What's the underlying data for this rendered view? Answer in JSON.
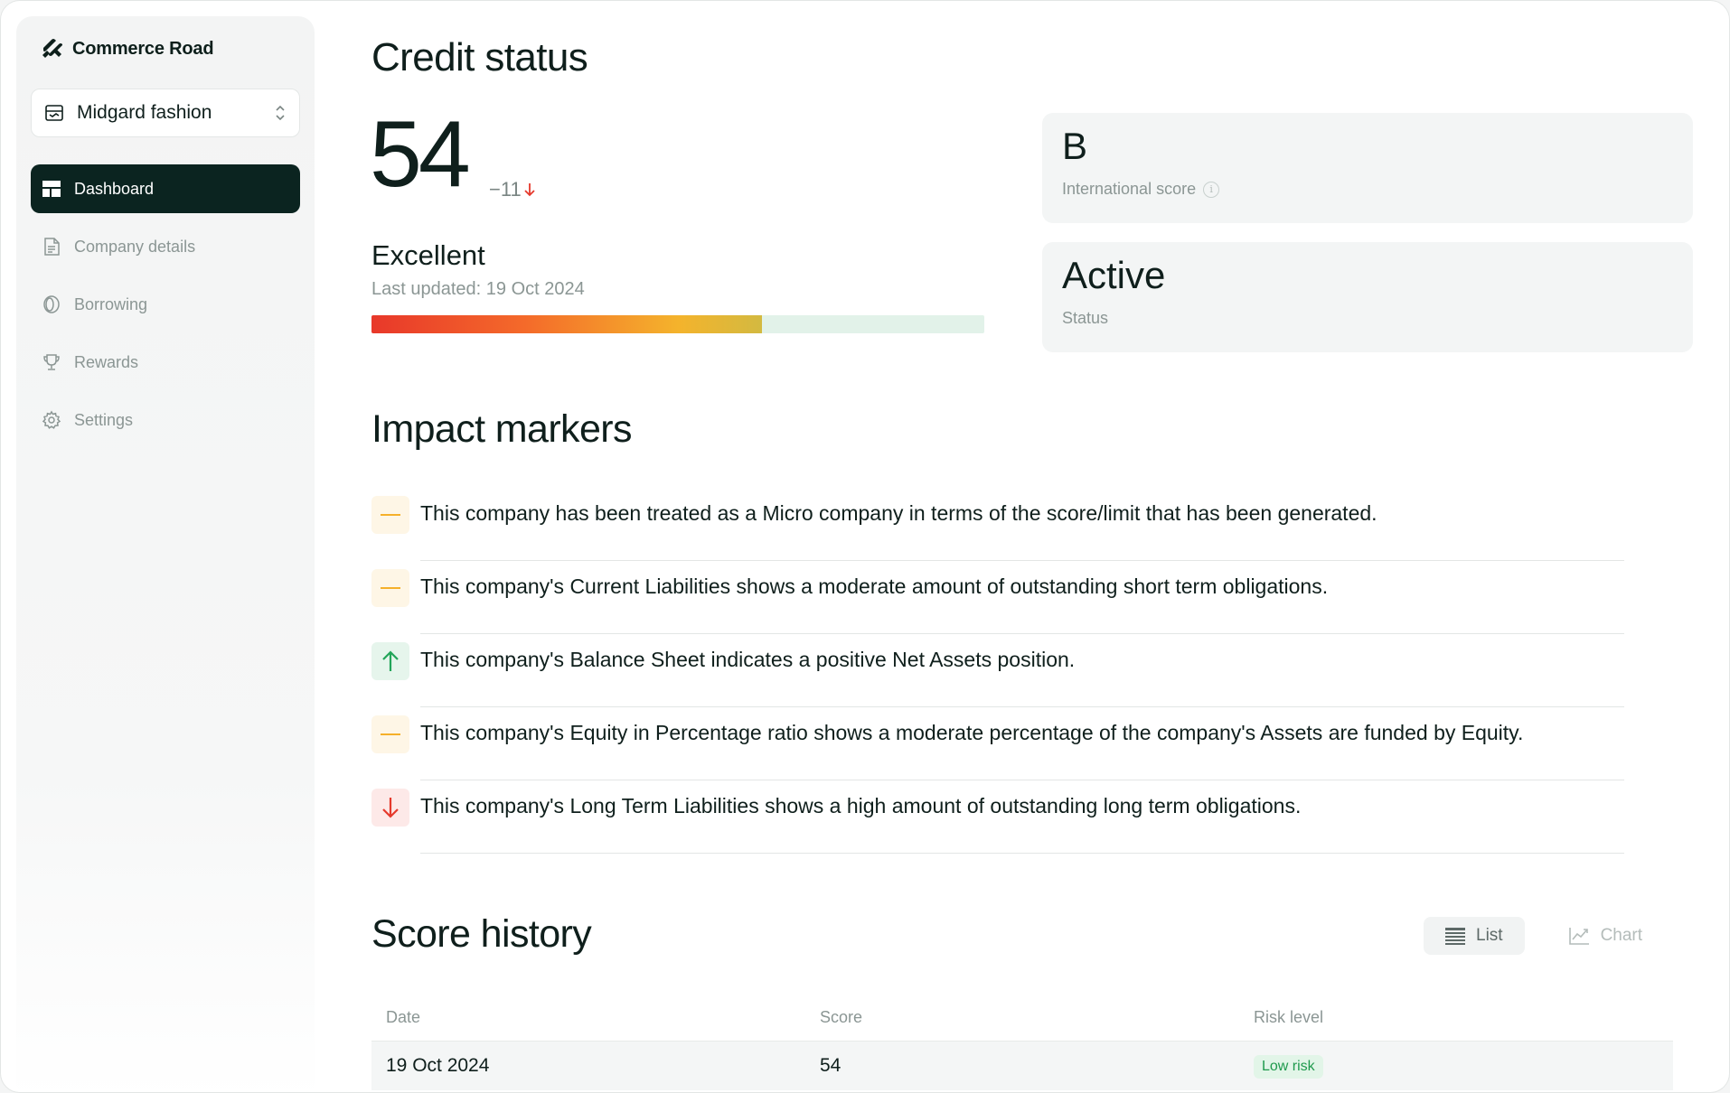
{
  "brand": {
    "name": "Commerce Road"
  },
  "org_selector": {
    "value": "Midgard fashion"
  },
  "nav": [
    {
      "label": "Dashboard",
      "icon": "dashboard-icon",
      "active": true
    },
    {
      "label": "Company details",
      "icon": "document-icon",
      "active": false
    },
    {
      "label": "Borrowing",
      "icon": "coin-icon",
      "active": false
    },
    {
      "label": "Rewards",
      "icon": "trophy-icon",
      "active": false
    },
    {
      "label": "Settings",
      "icon": "gear-icon",
      "active": false
    }
  ],
  "credit": {
    "title": "Credit status",
    "score": "54",
    "delta": "−11",
    "rating": "Excellent",
    "updated": "Last updated: 19 Oct 2024",
    "bar_fraction": 0.637
  },
  "cards": {
    "intl_value": "B",
    "intl_label": "International score",
    "status_value": "Active",
    "status_label": "Status"
  },
  "impact": {
    "title": "Impact markers",
    "items": [
      {
        "type": "neutral",
        "text": "This company has been treated as a Micro company in terms of the score/limit that has been generated."
      },
      {
        "type": "neutral",
        "text": "This company's Current Liabilities shows a moderate amount of outstanding short term obligations."
      },
      {
        "type": "positive",
        "text": "This company's Balance Sheet indicates a positive Net Assets position."
      },
      {
        "type": "neutral",
        "text": "This company's Equity in Percentage ratio shows a moderate percentage of the company's Assets are funded by Equity."
      },
      {
        "type": "negative",
        "text": "This company's Long Term Liabilities shows a high amount of outstanding long term obligations."
      }
    ]
  },
  "history": {
    "title": "Score history",
    "list_label": "List",
    "chart_label": "Chart",
    "columns": [
      "Date",
      "Score",
      "Risk level"
    ],
    "rows": [
      {
        "date": "19 Oct 2024",
        "score": "54",
        "risk": "Low risk"
      }
    ]
  },
  "colors": {
    "nav_active": "#0b2420",
    "neutral": "#f5b02a",
    "positive": "#22a559",
    "negative": "#e5392c"
  }
}
